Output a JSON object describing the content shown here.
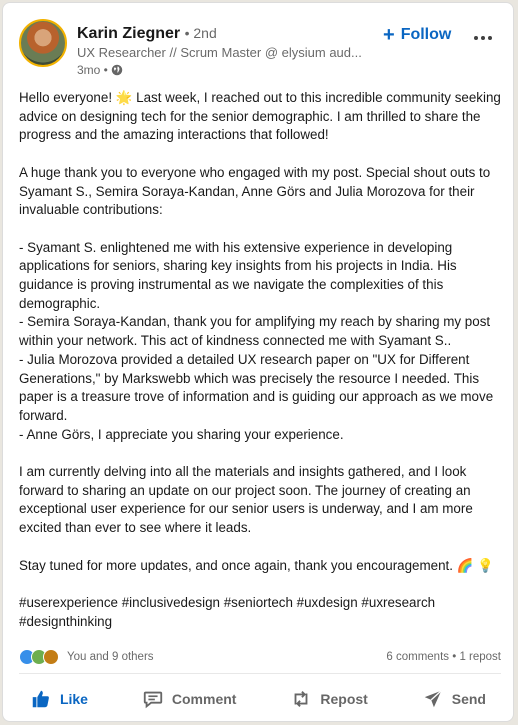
{
  "author": {
    "name": "Karin Ziegner",
    "degree": "• 2nd",
    "headline": "UX Researcher // Scrum Master @ elysium aud...",
    "time": "3mo •"
  },
  "follow_label": "Follow",
  "post": {
    "p1": "Hello everyone! 🌟 Last week, I reached out to this incredible community seeking advice on designing tech for the senior demographic. I am thrilled to share the progress and the amazing interactions that followed!",
    "p2": "A huge thank you to everyone who engaged with my post. Special shout outs to Syamant S., Semira Soraya-Kandan, Anne Görs and Julia Morozova for their invaluable contributions:",
    "b1": "- Syamant S. enlightened me with his extensive experience in developing applications for seniors, sharing key insights from his projects in India. His guidance is proving instrumental as we navigate the complexities of this demographic.",
    "b2": "- Semira Soraya-Kandan, thank you for amplifying my reach by sharing my post within your network. This act of kindness connected me with Syamant S..",
    "b3": "- Julia Morozova provided a detailed UX research paper on \"UX for Different Generations,\" by Markswebb which was precisely the resource I needed. This paper is a treasure trove of information and is guiding our approach as we move forward.",
    "b4": "- Anne Görs, I appreciate you sharing your experience.",
    "p3": "I am currently delving into all the materials and insights gathered, and I look forward to sharing an update on our project soon. The journey of creating an exceptional user experience for our senior users is underway, and I am more excited than ever to see where it leads.",
    "p4": "Stay tuned for more updates, and once again, thank you encouragement. 🌈 💡",
    "hashtags": "#userexperience #inclusivedesign #seniortech #uxdesign #uxresearch #designthinking"
  },
  "social": {
    "reactions_text": "You and 9 others",
    "counts": "6 comments • 1 repost"
  },
  "actions": {
    "like": "Like",
    "comment": "Comment",
    "repost": "Repost",
    "send": "Send"
  },
  "colors": {
    "accent": "#0a66c2",
    "like_reaction": "#378fe9",
    "support_reaction": "#6dae4f",
    "insight_reaction": "#c37d16"
  },
  "icons": {
    "globe": "globe-icon",
    "more": "more-icon",
    "like": "thumbs-up-icon",
    "comment": "comment-icon",
    "repost": "repost-icon",
    "send": "send-icon"
  }
}
